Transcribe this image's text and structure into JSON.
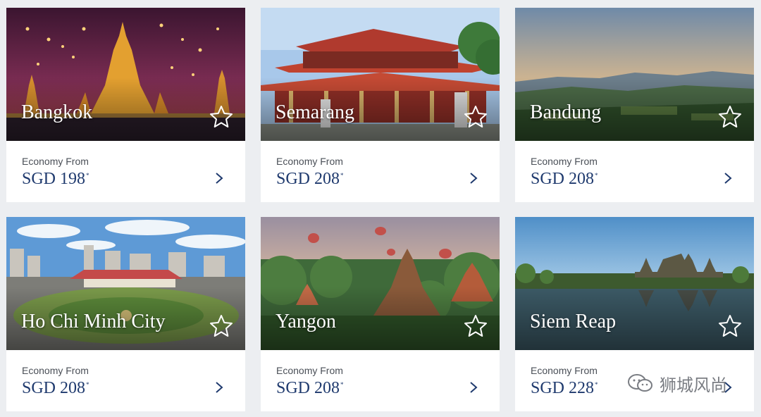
{
  "cards": [
    {
      "city": "Bangkok",
      "label": "Economy From",
      "currency": "SGD",
      "price": "198",
      "mark": "*"
    },
    {
      "city": "Semarang",
      "label": "Economy From",
      "currency": "SGD",
      "price": "208",
      "mark": "*"
    },
    {
      "city": "Bandung",
      "label": "Economy From",
      "currency": "SGD",
      "price": "208",
      "mark": "*"
    },
    {
      "city": "Ho Chi Minh City",
      "label": "Economy From",
      "currency": "SGD",
      "price": "208",
      "mark": "*"
    },
    {
      "city": "Yangon",
      "label": "Economy From",
      "currency": "SGD",
      "price": "208",
      "mark": "*"
    },
    {
      "city": "Siem Reap",
      "label": "Economy From",
      "currency": "SGD",
      "price": "228",
      "mark": "*"
    }
  ],
  "icons": {
    "favorite": "star-outline-icon",
    "details": "chevron-right-icon",
    "watermark": "wechat-icon"
  },
  "watermark": {
    "text": "狮城风尚"
  },
  "colors": {
    "price": "#1f3a6e",
    "label": "#4a4f57",
    "background": "#eceef1"
  }
}
